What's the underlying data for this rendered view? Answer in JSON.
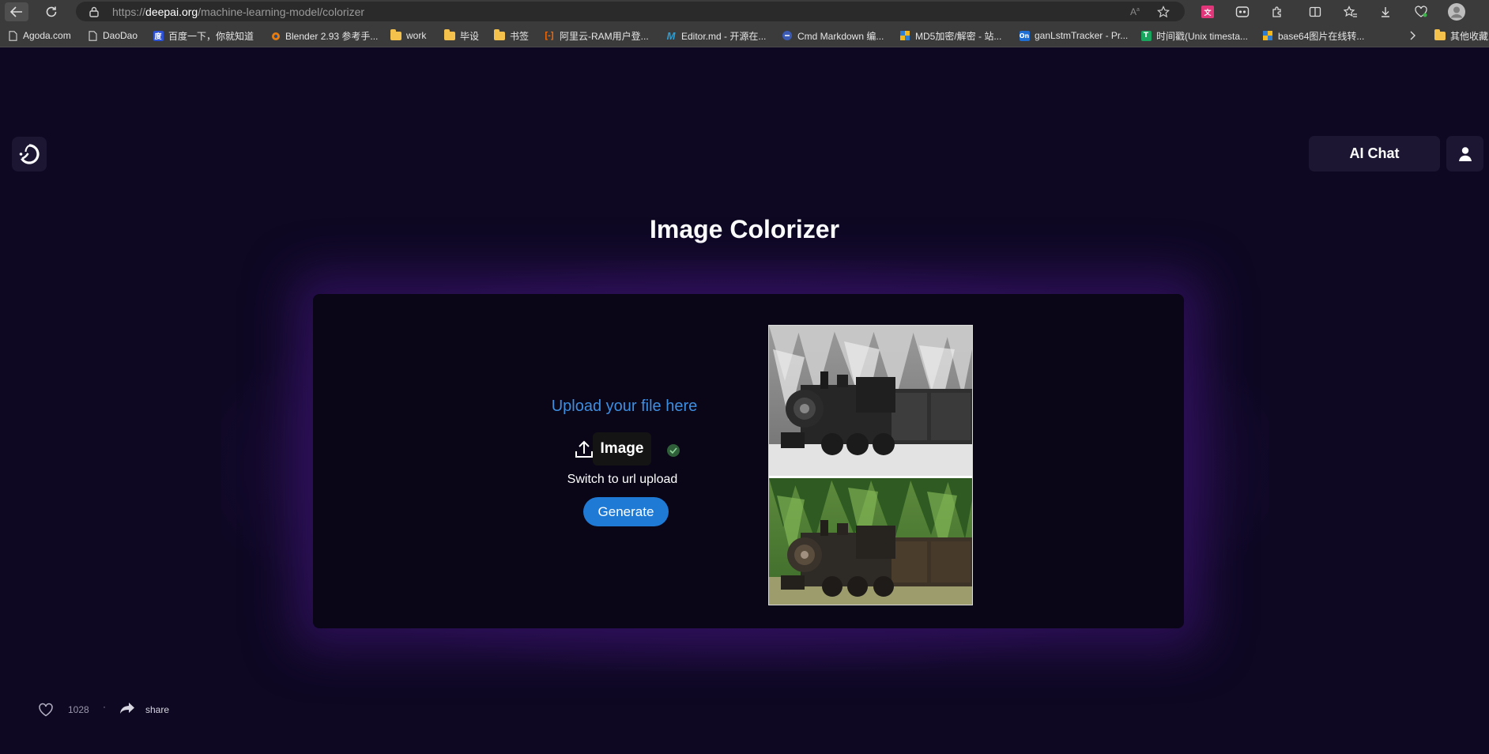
{
  "browser": {
    "url_prefix": "https://",
    "url_host": "deepai.org",
    "url_path": "/machine-learning-model/colorizer",
    "bookmarks": [
      {
        "label": "Agoda.com",
        "icon": "page-icon"
      },
      {
        "label": "DaoDao",
        "icon": "page-icon"
      },
      {
        "label": "百度一下，你就知道",
        "icon": "baidu-icon"
      },
      {
        "label": "Blender 2.93 参考手...",
        "icon": "blender-icon"
      },
      {
        "label": "work",
        "icon": "folder-icon"
      },
      {
        "label": "毕设",
        "icon": "folder-icon"
      },
      {
        "label": "书签",
        "icon": "folder-icon"
      },
      {
        "label": "阿里云-RAM用户登...",
        "icon": "aliyun-icon"
      },
      {
        "label": "Editor.md - 开源在...",
        "icon": "editormd-icon"
      },
      {
        "label": "Cmd Markdown 编...",
        "icon": "cmd-markdown-icon"
      },
      {
        "label": "MD5加密/解密 - 站...",
        "icon": "md5-icon"
      },
      {
        "label": "ganLstmTracker - Pr...",
        "icon": "overleaf-icon"
      },
      {
        "label": "时间戳(Unix timesta...",
        "icon": "timestamp-icon"
      },
      {
        "label": "base64图片在线转...",
        "icon": "base64-icon"
      }
    ],
    "other_bookmarks": "其他收藏"
  },
  "header": {
    "ai_chat_label": "AI Chat"
  },
  "main": {
    "title": "Image Colorizer",
    "upload_prompt": "Upload your file here",
    "image_tab_label": "Image",
    "switch_label": "Switch to url upload",
    "generate_label": "Generate"
  },
  "footer": {
    "like_count": "1028",
    "separator": "·",
    "share_label": "share"
  },
  "colors": {
    "page_bg": "#0e0823",
    "card_bg": "#0a0618",
    "accent_blue": "#1f7ad6",
    "link_blue": "#3e8ee0",
    "glow_purple": "#46168a"
  }
}
